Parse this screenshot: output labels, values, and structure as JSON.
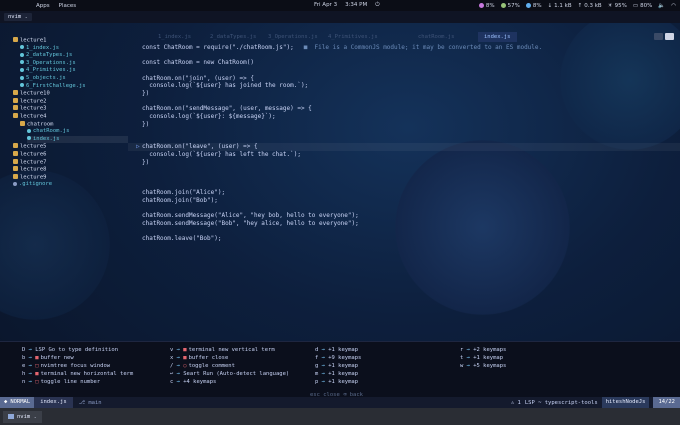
{
  "topbar": {
    "app_name": "Apps",
    "places": "Places",
    "date": "Fri Apr 3",
    "time": "3:34 PM",
    "cpu": "8%",
    "mem": "57%",
    "disk": "8%",
    "net_down": "1.1 kB",
    "net_up": "0.3 kB",
    "brightness": "95%",
    "battery": "80%"
  },
  "terminal": {
    "tab_title": "nvim ."
  },
  "tree": {
    "rows": [
      {
        "indent": 1,
        "kind": "dir",
        "label": "lecture1"
      },
      {
        "indent": 2,
        "kind": "file",
        "label": "1_index.js"
      },
      {
        "indent": 2,
        "kind": "file",
        "label": "2_dataTypes.js"
      },
      {
        "indent": 2,
        "kind": "file",
        "label": "3_Operations.js"
      },
      {
        "indent": 2,
        "kind": "file",
        "label": "4_Primitives.js"
      },
      {
        "indent": 2,
        "kind": "file",
        "label": "5_objects.js"
      },
      {
        "indent": 2,
        "kind": "file",
        "label": "6_FirstChallege.js"
      },
      {
        "indent": 1,
        "kind": "dir",
        "label": "lecture10"
      },
      {
        "indent": 1,
        "kind": "dir",
        "label": "lecture2"
      },
      {
        "indent": 1,
        "kind": "dir",
        "label": "lecture3"
      },
      {
        "indent": 1,
        "kind": "dir",
        "label": "lecture4"
      },
      {
        "indent": 2,
        "kind": "dir",
        "label": "chatroom"
      },
      {
        "indent": 3,
        "kind": "file",
        "label": "chatRoom.js"
      },
      {
        "indent": 3,
        "kind": "file",
        "label": "index.js"
      },
      {
        "indent": 1,
        "kind": "dir",
        "label": "lecture5"
      },
      {
        "indent": 1,
        "kind": "dir",
        "label": "lecture6"
      },
      {
        "indent": 1,
        "kind": "dir",
        "label": "lecture7"
      },
      {
        "indent": 1,
        "kind": "dir",
        "label": "lecture8"
      },
      {
        "indent": 1,
        "kind": "dir",
        "label": "lecture9"
      },
      {
        "indent": 1,
        "kind": "file",
        "label": ".gitignore"
      }
    ]
  },
  "editor": {
    "tabs": [
      {
        "label": "1_index.js"
      },
      {
        "label": "2_dataTypes.js"
      },
      {
        "label": "3_Operations.js"
      },
      {
        "label": "4_Primitives.js"
      },
      {
        "label": "chatRoom.js"
      },
      {
        "label": "index.js"
      }
    ],
    "active_tab": "index.js",
    "diagnostic": "■  File is a CommonJS module; it may be converted to an ES module.",
    "lines": [
      "const ChatRoom = require(\"./chatRoom.js\");",
      "",
      "const chatRoom = new ChatRoom()",
      "",
      "chatRoom.on(\"join\", (user) => {",
      "  console.log(`${user} has joined the room.`);",
      "})",
      "",
      "chatRoom.on(\"sendMessage\", (user, message) => {",
      "  console.log(`${user}: ${message}`);",
      "})",
      "",
      "",
      "chatRoom.on(\"leave\", (user) => {",
      "  console.log(`${user} has left the chat.`);",
      "})",
      "",
      "",
      "",
      "chatRoom.join(\"Alice\");",
      "chatRoom.join(\"Bob\");",
      "",
      "chatRoom.sendMessage(\"Alice\", \"hey bob, hello to everyone\");",
      "chatRoom.sendMessage(\"Bob\", \"hey alice, hello to everyone\");",
      "",
      "chatRoom.leave(\"Bob\");"
    ]
  },
  "whichkey": {
    "col1": [
      {
        "key": "D",
        "action": "LSP Go to type definition",
        "icon": ""
      },
      {
        "key": "b",
        "action": "buffer new",
        "icon": "■"
      },
      {
        "key": "e",
        "action": "nvimtree focus window",
        "icon": "□"
      },
      {
        "key": "h",
        "action": "terminal new horizontal term",
        "icon": "■"
      },
      {
        "key": "n",
        "action": "toggle line number",
        "icon": "□"
      }
    ],
    "col2": [
      {
        "key": "v",
        "action": "terminal new vertical term",
        "icon": "■"
      },
      {
        "key": "x",
        "action": "buffer close",
        "icon": "■"
      },
      {
        "key": "/",
        "action": "toggle comment",
        "icon": "○"
      },
      {
        "key": "↩",
        "action": "Seart Run (Auto-detect language)",
        "icon": ""
      },
      {
        "key": "c",
        "action": "+4 keymaps",
        "icon": ""
      }
    ],
    "col3": [
      {
        "key": "d",
        "action": "+1 keymap"
      },
      {
        "key": "f",
        "action": "+9 keymaps"
      },
      {
        "key": "g",
        "action": "+1 keymap"
      },
      {
        "key": "m",
        "action": "+1 keymap"
      },
      {
        "key": "p",
        "action": "+1 keymap"
      }
    ],
    "col4": [
      {
        "key": "r",
        "action": "+2 keymaps"
      },
      {
        "key": "t",
        "action": "+1 keymap"
      },
      {
        "key": "w",
        "action": "+5 keymaps"
      }
    ],
    "hint": "esc close  ⌫ back"
  },
  "status": {
    "mode": "NORMAL",
    "file": "index.js",
    "branch": "main",
    "diag": "1",
    "lsp": "LSP ~ typescript-tools",
    "project": "hiteshNodeJs",
    "position": "14/22"
  },
  "taskbar": {
    "task": "nvim ."
  },
  "colors": {
    "accent": "#7aa2f7",
    "bg": "#0d1f3d",
    "statusline": "#141a2d"
  }
}
